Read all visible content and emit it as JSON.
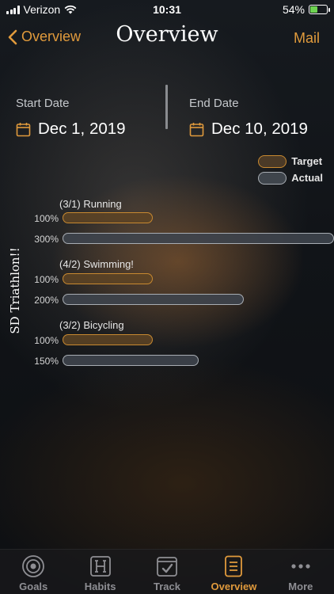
{
  "status_bar": {
    "carrier": "Verizon",
    "time": "10:31",
    "battery": "54%",
    "battery_level": 0.54
  },
  "nav": {
    "back_label": "Overview",
    "title": "Overview",
    "right_label": "Mail"
  },
  "dates": {
    "start_label": "Start Date",
    "start_value": "Dec 1, 2019",
    "end_label": "End Date",
    "end_value": "Dec 10, 2019"
  },
  "legend": {
    "target_label": "Target",
    "actual_label": "Actual"
  },
  "goal_title": "SD Triathlon!!",
  "habits": [
    {
      "name": "(3/1) Running",
      "target_label": "100%",
      "target_value": 1.0,
      "actual_label": "300%",
      "actual_value": 3.0
    },
    {
      "name": "(4/2) Swimming!",
      "target_label": "100%",
      "target_value": 1.0,
      "actual_label": "200%",
      "actual_value": 2.0
    },
    {
      "name": "(3/2) Bicycling",
      "target_label": "100%",
      "target_value": 1.0,
      "actual_label": "150%",
      "actual_value": 1.5
    }
  ],
  "tabs": [
    {
      "label": "Goals",
      "icon": "target-icon",
      "active": false
    },
    {
      "label": "Habits",
      "icon": "habits-h-icon",
      "active": false
    },
    {
      "label": "Track",
      "icon": "checkmark-box-icon",
      "active": false
    },
    {
      "label": "Overview",
      "icon": "list-icon",
      "active": true
    },
    {
      "label": "More",
      "icon": "more-dots-icon",
      "active": false
    }
  ],
  "colors": {
    "accent": "#e09a3c",
    "target_border": "#c88930",
    "actual_border": "#a8adb3",
    "battery_green": "#6ed452"
  }
}
